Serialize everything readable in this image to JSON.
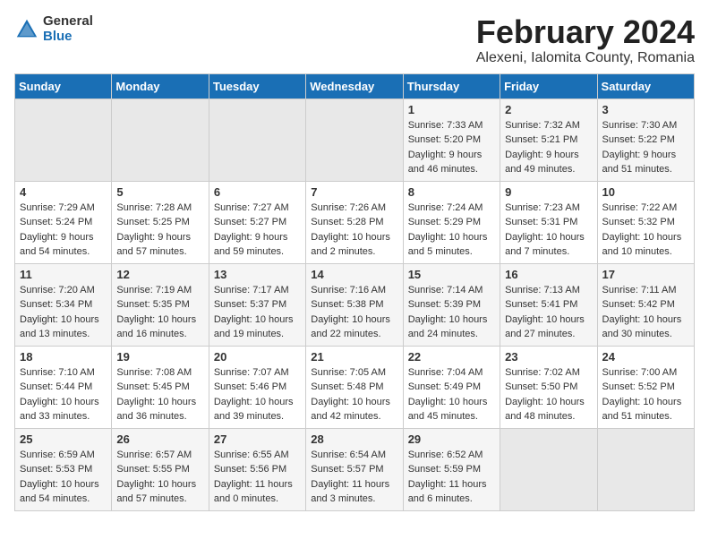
{
  "header": {
    "logo_general": "General",
    "logo_blue": "Blue",
    "month": "February 2024",
    "location": "Alexeni, Ialomita County, Romania"
  },
  "weekdays": [
    "Sunday",
    "Monday",
    "Tuesday",
    "Wednesday",
    "Thursday",
    "Friday",
    "Saturday"
  ],
  "weeks": [
    [
      {
        "day": "",
        "info": ""
      },
      {
        "day": "",
        "info": ""
      },
      {
        "day": "",
        "info": ""
      },
      {
        "day": "",
        "info": ""
      },
      {
        "day": "1",
        "info": "Sunrise: 7:33 AM\nSunset: 5:20 PM\nDaylight: 9 hours\nand 46 minutes."
      },
      {
        "day": "2",
        "info": "Sunrise: 7:32 AM\nSunset: 5:21 PM\nDaylight: 9 hours\nand 49 minutes."
      },
      {
        "day": "3",
        "info": "Sunrise: 7:30 AM\nSunset: 5:22 PM\nDaylight: 9 hours\nand 51 minutes."
      }
    ],
    [
      {
        "day": "4",
        "info": "Sunrise: 7:29 AM\nSunset: 5:24 PM\nDaylight: 9 hours\nand 54 minutes."
      },
      {
        "day": "5",
        "info": "Sunrise: 7:28 AM\nSunset: 5:25 PM\nDaylight: 9 hours\nand 57 minutes."
      },
      {
        "day": "6",
        "info": "Sunrise: 7:27 AM\nSunset: 5:27 PM\nDaylight: 9 hours\nand 59 minutes."
      },
      {
        "day": "7",
        "info": "Sunrise: 7:26 AM\nSunset: 5:28 PM\nDaylight: 10 hours\nand 2 minutes."
      },
      {
        "day": "8",
        "info": "Sunrise: 7:24 AM\nSunset: 5:29 PM\nDaylight: 10 hours\nand 5 minutes."
      },
      {
        "day": "9",
        "info": "Sunrise: 7:23 AM\nSunset: 5:31 PM\nDaylight: 10 hours\nand 7 minutes."
      },
      {
        "day": "10",
        "info": "Sunrise: 7:22 AM\nSunset: 5:32 PM\nDaylight: 10 hours\nand 10 minutes."
      }
    ],
    [
      {
        "day": "11",
        "info": "Sunrise: 7:20 AM\nSunset: 5:34 PM\nDaylight: 10 hours\nand 13 minutes."
      },
      {
        "day": "12",
        "info": "Sunrise: 7:19 AM\nSunset: 5:35 PM\nDaylight: 10 hours\nand 16 minutes."
      },
      {
        "day": "13",
        "info": "Sunrise: 7:17 AM\nSunset: 5:37 PM\nDaylight: 10 hours\nand 19 minutes."
      },
      {
        "day": "14",
        "info": "Sunrise: 7:16 AM\nSunset: 5:38 PM\nDaylight: 10 hours\nand 22 minutes."
      },
      {
        "day": "15",
        "info": "Sunrise: 7:14 AM\nSunset: 5:39 PM\nDaylight: 10 hours\nand 24 minutes."
      },
      {
        "day": "16",
        "info": "Sunrise: 7:13 AM\nSunset: 5:41 PM\nDaylight: 10 hours\nand 27 minutes."
      },
      {
        "day": "17",
        "info": "Sunrise: 7:11 AM\nSunset: 5:42 PM\nDaylight: 10 hours\nand 30 minutes."
      }
    ],
    [
      {
        "day": "18",
        "info": "Sunrise: 7:10 AM\nSunset: 5:44 PM\nDaylight: 10 hours\nand 33 minutes."
      },
      {
        "day": "19",
        "info": "Sunrise: 7:08 AM\nSunset: 5:45 PM\nDaylight: 10 hours\nand 36 minutes."
      },
      {
        "day": "20",
        "info": "Sunrise: 7:07 AM\nSunset: 5:46 PM\nDaylight: 10 hours\nand 39 minutes."
      },
      {
        "day": "21",
        "info": "Sunrise: 7:05 AM\nSunset: 5:48 PM\nDaylight: 10 hours\nand 42 minutes."
      },
      {
        "day": "22",
        "info": "Sunrise: 7:04 AM\nSunset: 5:49 PM\nDaylight: 10 hours\nand 45 minutes."
      },
      {
        "day": "23",
        "info": "Sunrise: 7:02 AM\nSunset: 5:50 PM\nDaylight: 10 hours\nand 48 minutes."
      },
      {
        "day": "24",
        "info": "Sunrise: 7:00 AM\nSunset: 5:52 PM\nDaylight: 10 hours\nand 51 minutes."
      }
    ],
    [
      {
        "day": "25",
        "info": "Sunrise: 6:59 AM\nSunset: 5:53 PM\nDaylight: 10 hours\nand 54 minutes."
      },
      {
        "day": "26",
        "info": "Sunrise: 6:57 AM\nSunset: 5:55 PM\nDaylight: 10 hours\nand 57 minutes."
      },
      {
        "day": "27",
        "info": "Sunrise: 6:55 AM\nSunset: 5:56 PM\nDaylight: 11 hours\nand 0 minutes."
      },
      {
        "day": "28",
        "info": "Sunrise: 6:54 AM\nSunset: 5:57 PM\nDaylight: 11 hours\nand 3 minutes."
      },
      {
        "day": "29",
        "info": "Sunrise: 6:52 AM\nSunset: 5:59 PM\nDaylight: 11 hours\nand 6 minutes."
      },
      {
        "day": "",
        "info": ""
      },
      {
        "day": "",
        "info": ""
      }
    ]
  ]
}
